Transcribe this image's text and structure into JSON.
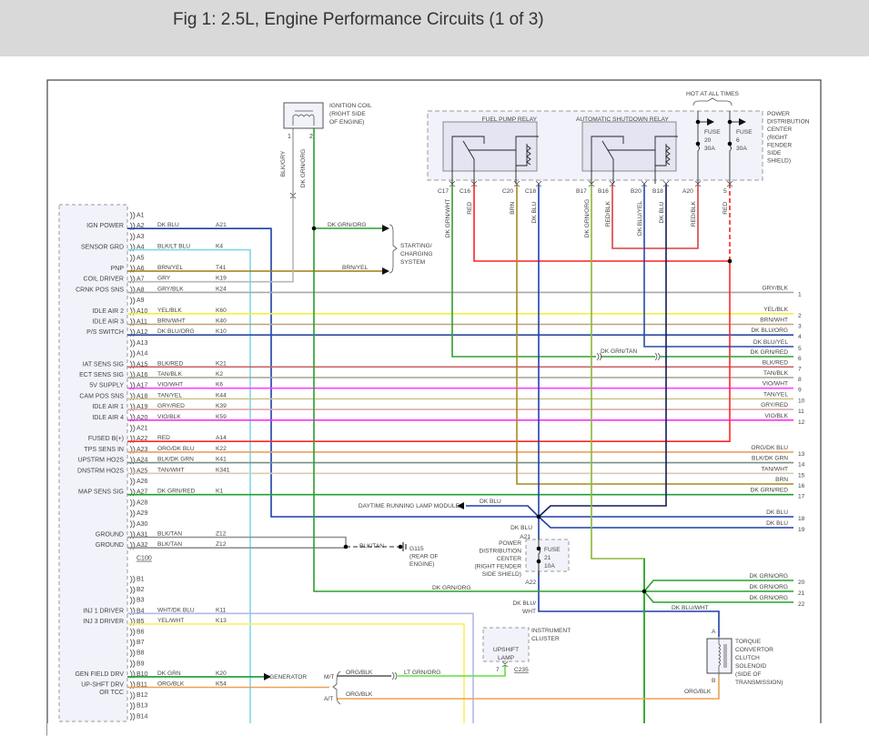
{
  "title": "Fig 1: 2.5L, Engine Performance Circuits (1 of 3)",
  "pcm": {
    "connector_a": "C100",
    "pins": [
      {
        "pin": "A1",
        "name": "",
        "wire": "",
        "circuit": "",
        "color": ""
      },
      {
        "pin": "A2",
        "name": "IGN POWER",
        "wire": "DK BLU",
        "circuit": "A21",
        "color": "#1f3fa8"
      },
      {
        "pin": "A3",
        "name": "",
        "wire": "",
        "circuit": "",
        "color": ""
      },
      {
        "pin": "A4",
        "name": "SENSOR GRD",
        "wire": "BLK/LT BLU",
        "circuit": "K4",
        "color": "#7fd8e6"
      },
      {
        "pin": "A5",
        "name": "",
        "wire": "",
        "circuit": "",
        "color": ""
      },
      {
        "pin": "A6",
        "name": "PNP",
        "wire": "BRN/YEL",
        "circuit": "T41",
        "color": "#a07a10"
      },
      {
        "pin": "A7",
        "name": "COIL DRIVER",
        "wire": "GRY",
        "circuit": "K19",
        "color": "#b8b8b8"
      },
      {
        "pin": "A8",
        "name": "CRNK POS SNS",
        "wire": "GRY/BLK",
        "circuit": "K24",
        "color": "#a8a8a8"
      },
      {
        "pin": "A9",
        "name": "",
        "wire": "",
        "circuit": "",
        "color": ""
      },
      {
        "pin": "A10",
        "name": "IDLE AIR 2",
        "wire": "YEL/BLK",
        "circuit": "K60",
        "color": "#f4f040"
      },
      {
        "pin": "A11",
        "name": "IDLE AIR 3",
        "wire": "BRN/WHT",
        "circuit": "K40",
        "color": "#b9a47c"
      },
      {
        "pin": "A12",
        "name": "P/S SWITCH",
        "wire": "DK BLU/ORG",
        "circuit": "K10",
        "color": "#2c48a0"
      },
      {
        "pin": "A13",
        "name": "",
        "wire": "",
        "circuit": "",
        "color": ""
      },
      {
        "pin": "A14",
        "name": "",
        "wire": "",
        "circuit": "",
        "color": ""
      },
      {
        "pin": "A15",
        "name": "IAT SENS SIG",
        "wire": "BLK/RED",
        "circuit": "K21",
        "color": "#c86464"
      },
      {
        "pin": "A16",
        "name": "ECT SENS SIG",
        "wire": "TAN/BLK",
        "circuit": "K2",
        "color": "#a8a090"
      },
      {
        "pin": "A17",
        "name": "5V SUPPLY",
        "wire": "VIO/WHT",
        "circuit": "K6",
        "color": "#ff40ff"
      },
      {
        "pin": "A18",
        "name": "CAM POS SNS",
        "wire": "TAN/YEL",
        "circuit": "K44",
        "color": "#cfc48c"
      },
      {
        "pin": "A19",
        "name": "IDLE AIR 1",
        "wire": "GRY/RED",
        "circuit": "K39",
        "color": "#e0a8a8"
      },
      {
        "pin": "A20",
        "name": "IDLE AIR 4",
        "wire": "VIO/BLK",
        "circuit": "K59",
        "color": "#ff30f0"
      },
      {
        "pin": "A21",
        "name": "",
        "wire": "",
        "circuit": "",
        "color": ""
      },
      {
        "pin": "A22",
        "name": "FUSED B(+)",
        "wire": "RED",
        "circuit": "A14",
        "color": "#ff2828"
      },
      {
        "pin": "A23",
        "name": "TPS SENS IN",
        "wire": "ORG/DK BLU",
        "circuit": "K22",
        "color": "#e8a060"
      },
      {
        "pin": "A24",
        "name": "UPSTRM HO2S",
        "wire": "BLK/DK GRN",
        "circuit": "K41",
        "color": "#7a9080"
      },
      {
        "pin": "A25",
        "name": "DNSTRM HO2S",
        "wire": "TAN/WHT",
        "circuit": "K341",
        "color": "#d8ccb0"
      },
      {
        "pin": "A26",
        "name": "",
        "wire": "",
        "circuit": "",
        "color": ""
      },
      {
        "pin": "A27",
        "name": "MAP SENS SIG",
        "wire": "DK GRN/RED",
        "circuit": "K1",
        "color": "#20a030"
      },
      {
        "pin": "A28",
        "name": "",
        "wire": "",
        "circuit": "",
        "color": ""
      },
      {
        "pin": "A29",
        "name": "",
        "wire": "",
        "circuit": "",
        "color": ""
      },
      {
        "pin": "A30",
        "name": "",
        "wire": "",
        "circuit": "",
        "color": ""
      },
      {
        "pin": "A31",
        "name": "GROUND",
        "wire": "BLK/TAN",
        "circuit": "Z12",
        "color": "#909090"
      },
      {
        "pin": "A32",
        "name": "GROUND",
        "wire": "BLK/TAN",
        "circuit": "Z12",
        "color": "#909090"
      },
      {
        "pin": "B1",
        "name": "",
        "wire": "",
        "circuit": "",
        "color": ""
      },
      {
        "pin": "B2",
        "name": "",
        "wire": "",
        "circuit": "",
        "color": ""
      },
      {
        "pin": "B3",
        "name": "",
        "wire": "",
        "circuit": "",
        "color": ""
      },
      {
        "pin": "B4",
        "name": "INJ 1 DRIVER",
        "wire": "WHT/DK BLU",
        "circuit": "K11",
        "color": "#b4b8e8"
      },
      {
        "pin": "B5",
        "name": "INJ 3 DRIVER",
        "wire": "YEL/WHT",
        "circuit": "K13",
        "color": "#f8f060"
      },
      {
        "pin": "B6",
        "name": "",
        "wire": "",
        "circuit": "",
        "color": ""
      },
      {
        "pin": "B7",
        "name": "",
        "wire": "",
        "circuit": "",
        "color": ""
      },
      {
        "pin": "B8",
        "name": "",
        "wire": "",
        "circuit": "",
        "color": ""
      },
      {
        "pin": "B9",
        "name": "",
        "wire": "",
        "circuit": "",
        "color": ""
      },
      {
        "pin": "B10",
        "name": "GEN FIELD DRV",
        "wire": "DK GRN",
        "circuit": "K20",
        "color": "#189a28"
      },
      {
        "pin": "B11",
        "name": "UP-SHFT DRV OR TCC",
        "wire": "ORG/BLK",
        "circuit": "K54",
        "color": "#f0a050"
      },
      {
        "pin": "B12",
        "name": "",
        "wire": "",
        "circuit": "",
        "color": ""
      },
      {
        "pin": "B13",
        "name": "",
        "wire": "",
        "circuit": "",
        "color": ""
      },
      {
        "pin": "B14",
        "name": "",
        "wire": "",
        "circuit": "",
        "color": ""
      }
    ]
  },
  "outputs": [
    {
      "num": "1",
      "wire": "GRY/BLK"
    },
    {
      "num": "2",
      "wire": "YEL/BLK"
    },
    {
      "num": "3",
      "wire": "BRN/WHT"
    },
    {
      "num": "4",
      "wire": "DK BLU/ORG"
    },
    {
      "num": "5",
      "wire": "DK BLU/YEL"
    },
    {
      "num": "6",
      "wire": "DK GRN/RED"
    },
    {
      "num": "7",
      "wire": "BLK/RED"
    },
    {
      "num": "8",
      "wire": "TAN/BLK"
    },
    {
      "num": "9",
      "wire": "VIO/WHT"
    },
    {
      "num": "10",
      "wire": "TAN/YEL"
    },
    {
      "num": "11",
      "wire": "GRY/RED"
    },
    {
      "num": "12",
      "wire": "VIO/BLK"
    },
    {
      "num": "13",
      "wire": "ORG/DK BLU"
    },
    {
      "num": "14",
      "wire": "BLK/DK GRN"
    },
    {
      "num": "15",
      "wire": "TAN/WHT"
    },
    {
      "num": "16",
      "wire": "BRN"
    },
    {
      "num": "17",
      "wire": "DK GRN/RED"
    },
    {
      "num": "18",
      "wire": "DK BLU"
    },
    {
      "num": "19",
      "wire": "DK BLU"
    },
    {
      "num": "20",
      "wire": "DK GRN/ORG"
    },
    {
      "num": "21",
      "wire": "DK GRN/ORG"
    },
    {
      "num": "22",
      "wire": "DK GRN/ORG"
    }
  ],
  "ignition_coil": {
    "label1": "IGNITION COIL",
    "label2": "(RIGHT SIDE",
    "label3": "OF ENGINE)",
    "pin1": "1",
    "pin2": "2",
    "wire1": "BLK/GRY",
    "wire2": "DK GRN/ORG"
  },
  "starting": {
    "wire1": "DK GRN/ORG",
    "wire2": "BRN/YEL",
    "l1": "STARTING/",
    "l2": "CHARGING",
    "l3": "SYSTEM"
  },
  "pdc": {
    "hot": "HOT AT ALL TIMES",
    "fuel_pump_relay": "FUEL PUMP RELAY",
    "asd_relay": "AUTOMATIC SHUTDOWN RELAY",
    "fuse20": [
      "FUSE",
      "20",
      "30A"
    ],
    "fuse6": [
      "FUSE",
      "6",
      "30A"
    ],
    "label": [
      "POWER",
      "DISTRIBUTION",
      "CENTER",
      "(RIGHT",
      "FENDER",
      "SIDE",
      "SHIELD)"
    ],
    "pins": [
      {
        "pin": "C17",
        "wire": "DK GRN/WHT"
      },
      {
        "pin": "C16",
        "wire": "RED"
      },
      {
        "pin": "C20",
        "wire": "BRN"
      },
      {
        "pin": "C18",
        "wire": "DK BLU"
      },
      {
        "pin": "B17",
        "wire": "DK GRN/ORG"
      },
      {
        "pin": "B16",
        "wire": "RED/BLK"
      },
      {
        "pin": "B20",
        "wire": "DK BLU/YEL"
      },
      {
        "pin": "B18",
        "wire": "DK BLU"
      },
      {
        "pin": "A20",
        "wire": "RED/BLK"
      },
      {
        "pin": "5",
        "wire": "RED"
      }
    ]
  },
  "splice": {
    "dk_grn_tan": "DK GRN/TAN"
  },
  "drl": {
    "label": "DAYTIME RUNNING LAMP MODULE",
    "wire": "DK BLU"
  },
  "fuse21": {
    "wire_in": "DK BLU",
    "pin_in": "A21",
    "pin_out": "A22",
    "fuse": [
      "FUSE",
      "21",
      "10A"
    ],
    "label": [
      "POWER",
      "DISTRIBUTION",
      "CENTER",
      "(RIGHT FENDER",
      "SIDE SHIELD)"
    ],
    "wire_out": [
      "DK BLU/",
      "WHT"
    ]
  },
  "ground": {
    "wire": "BLK/TAN",
    "id": "G115",
    "loc1": "(REAR OF",
    "loc2": "ENGINE)"
  },
  "dk_grn_org": "DK GRN/ORG",
  "dk_blu_wht": "DK BLU/WHT",
  "generator": "GENERATOR",
  "upshift": {
    "mt": "M/T",
    "at": "A/T",
    "wire_mt": "ORG/BLK",
    "wire_lt": "LT GRN/ORG",
    "wire_at": "ORG/BLK",
    "lamp": [
      "UPSHIFT",
      "LAMP"
    ],
    "cluster": [
      "INSTRUMENT",
      "CLUSTER"
    ],
    "pin": "7",
    "conn": "C235"
  },
  "tcc": {
    "pin_a": "A",
    "pin_b": "B",
    "wire_b": "ORG/BLK",
    "label": [
      "TORQUE",
      "CONVERTOR",
      "CLUTCH",
      "SOLENOID",
      "(SIDE OF",
      "TRANSMISSION)"
    ]
  }
}
